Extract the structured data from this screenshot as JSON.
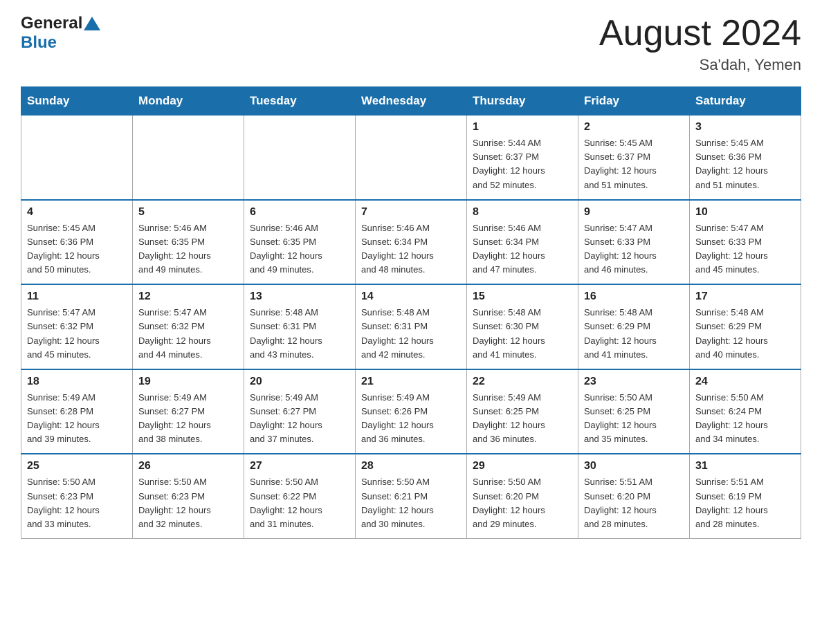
{
  "header": {
    "logo_general": "General",
    "logo_blue": "Blue",
    "month_title": "August 2024",
    "location": "Sa'dah, Yemen"
  },
  "weekdays": [
    "Sunday",
    "Monday",
    "Tuesday",
    "Wednesday",
    "Thursday",
    "Friday",
    "Saturday"
  ],
  "weeks": [
    [
      {
        "day": "",
        "info": ""
      },
      {
        "day": "",
        "info": ""
      },
      {
        "day": "",
        "info": ""
      },
      {
        "day": "",
        "info": ""
      },
      {
        "day": "1",
        "info": "Sunrise: 5:44 AM\nSunset: 6:37 PM\nDaylight: 12 hours\nand 52 minutes."
      },
      {
        "day": "2",
        "info": "Sunrise: 5:45 AM\nSunset: 6:37 PM\nDaylight: 12 hours\nand 51 minutes."
      },
      {
        "day": "3",
        "info": "Sunrise: 5:45 AM\nSunset: 6:36 PM\nDaylight: 12 hours\nand 51 minutes."
      }
    ],
    [
      {
        "day": "4",
        "info": "Sunrise: 5:45 AM\nSunset: 6:36 PM\nDaylight: 12 hours\nand 50 minutes."
      },
      {
        "day": "5",
        "info": "Sunrise: 5:46 AM\nSunset: 6:35 PM\nDaylight: 12 hours\nand 49 minutes."
      },
      {
        "day": "6",
        "info": "Sunrise: 5:46 AM\nSunset: 6:35 PM\nDaylight: 12 hours\nand 49 minutes."
      },
      {
        "day": "7",
        "info": "Sunrise: 5:46 AM\nSunset: 6:34 PM\nDaylight: 12 hours\nand 48 minutes."
      },
      {
        "day": "8",
        "info": "Sunrise: 5:46 AM\nSunset: 6:34 PM\nDaylight: 12 hours\nand 47 minutes."
      },
      {
        "day": "9",
        "info": "Sunrise: 5:47 AM\nSunset: 6:33 PM\nDaylight: 12 hours\nand 46 minutes."
      },
      {
        "day": "10",
        "info": "Sunrise: 5:47 AM\nSunset: 6:33 PM\nDaylight: 12 hours\nand 45 minutes."
      }
    ],
    [
      {
        "day": "11",
        "info": "Sunrise: 5:47 AM\nSunset: 6:32 PM\nDaylight: 12 hours\nand 45 minutes."
      },
      {
        "day": "12",
        "info": "Sunrise: 5:47 AM\nSunset: 6:32 PM\nDaylight: 12 hours\nand 44 minutes."
      },
      {
        "day": "13",
        "info": "Sunrise: 5:48 AM\nSunset: 6:31 PM\nDaylight: 12 hours\nand 43 minutes."
      },
      {
        "day": "14",
        "info": "Sunrise: 5:48 AM\nSunset: 6:31 PM\nDaylight: 12 hours\nand 42 minutes."
      },
      {
        "day": "15",
        "info": "Sunrise: 5:48 AM\nSunset: 6:30 PM\nDaylight: 12 hours\nand 41 minutes."
      },
      {
        "day": "16",
        "info": "Sunrise: 5:48 AM\nSunset: 6:29 PM\nDaylight: 12 hours\nand 41 minutes."
      },
      {
        "day": "17",
        "info": "Sunrise: 5:48 AM\nSunset: 6:29 PM\nDaylight: 12 hours\nand 40 minutes."
      }
    ],
    [
      {
        "day": "18",
        "info": "Sunrise: 5:49 AM\nSunset: 6:28 PM\nDaylight: 12 hours\nand 39 minutes."
      },
      {
        "day": "19",
        "info": "Sunrise: 5:49 AM\nSunset: 6:27 PM\nDaylight: 12 hours\nand 38 minutes."
      },
      {
        "day": "20",
        "info": "Sunrise: 5:49 AM\nSunset: 6:27 PM\nDaylight: 12 hours\nand 37 minutes."
      },
      {
        "day": "21",
        "info": "Sunrise: 5:49 AM\nSunset: 6:26 PM\nDaylight: 12 hours\nand 36 minutes."
      },
      {
        "day": "22",
        "info": "Sunrise: 5:49 AM\nSunset: 6:25 PM\nDaylight: 12 hours\nand 36 minutes."
      },
      {
        "day": "23",
        "info": "Sunrise: 5:50 AM\nSunset: 6:25 PM\nDaylight: 12 hours\nand 35 minutes."
      },
      {
        "day": "24",
        "info": "Sunrise: 5:50 AM\nSunset: 6:24 PM\nDaylight: 12 hours\nand 34 minutes."
      }
    ],
    [
      {
        "day": "25",
        "info": "Sunrise: 5:50 AM\nSunset: 6:23 PM\nDaylight: 12 hours\nand 33 minutes."
      },
      {
        "day": "26",
        "info": "Sunrise: 5:50 AM\nSunset: 6:23 PM\nDaylight: 12 hours\nand 32 minutes."
      },
      {
        "day": "27",
        "info": "Sunrise: 5:50 AM\nSunset: 6:22 PM\nDaylight: 12 hours\nand 31 minutes."
      },
      {
        "day": "28",
        "info": "Sunrise: 5:50 AM\nSunset: 6:21 PM\nDaylight: 12 hours\nand 30 minutes."
      },
      {
        "day": "29",
        "info": "Sunrise: 5:50 AM\nSunset: 6:20 PM\nDaylight: 12 hours\nand 29 minutes."
      },
      {
        "day": "30",
        "info": "Sunrise: 5:51 AM\nSunset: 6:20 PM\nDaylight: 12 hours\nand 28 minutes."
      },
      {
        "day": "31",
        "info": "Sunrise: 5:51 AM\nSunset: 6:19 PM\nDaylight: 12 hours\nand 28 minutes."
      }
    ]
  ]
}
